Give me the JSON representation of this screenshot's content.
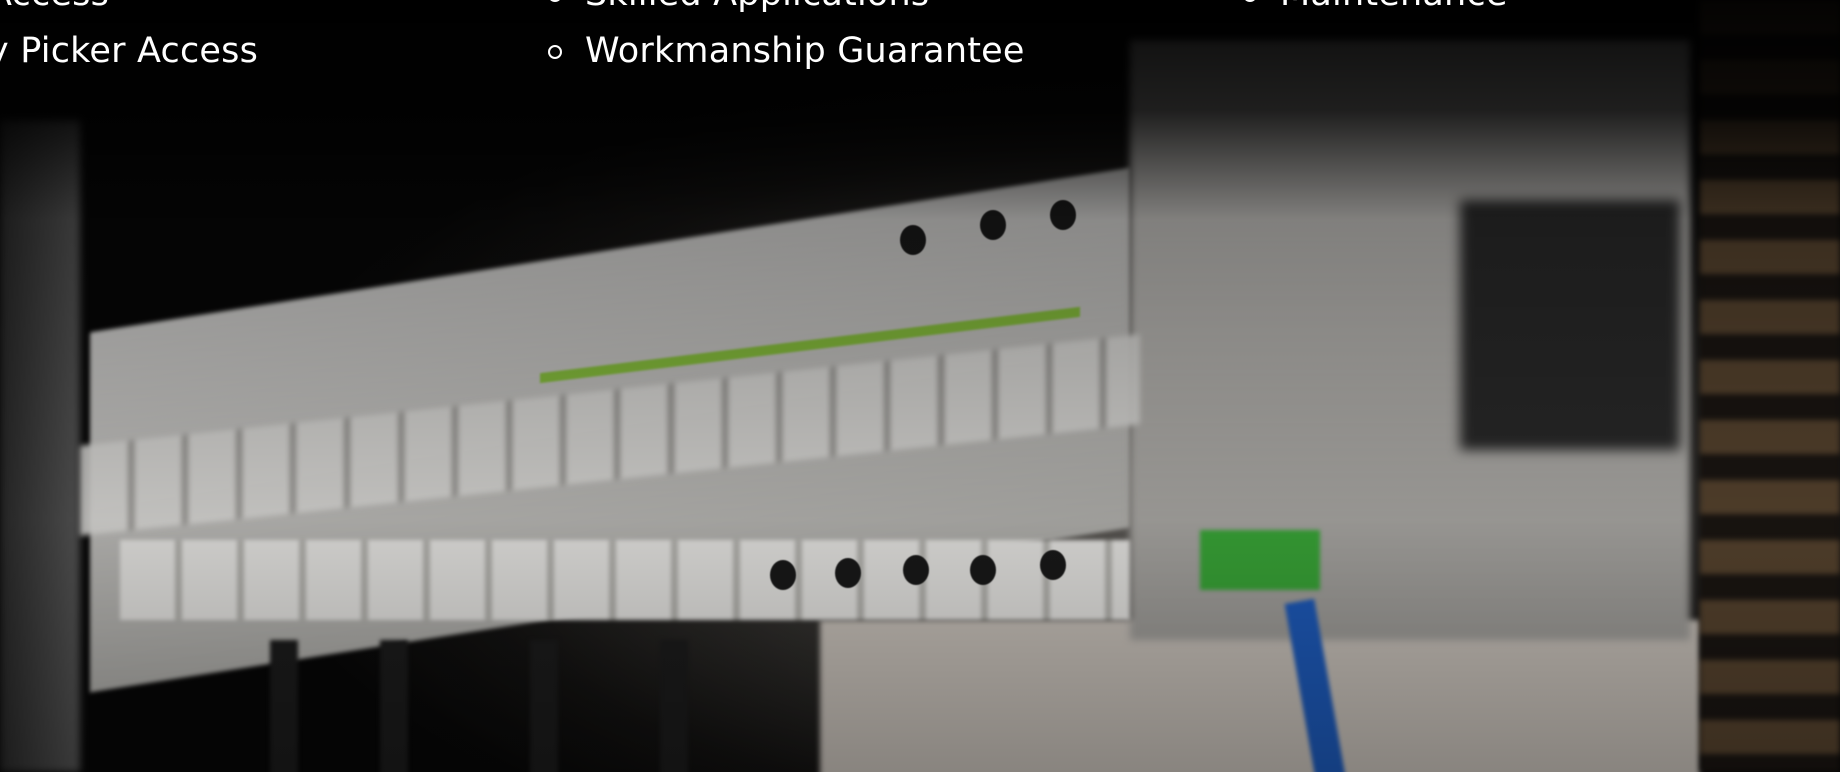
{
  "features": {
    "column_1": [
      {
        "label": "Access"
      },
      {
        "label": "y Picker Access"
      }
    ],
    "column_2": [
      {
        "label": "Skilled Applications"
      },
      {
        "label": "Workmanship Guarantee"
      }
    ],
    "column_3": [
      {
        "label": "Maintenance"
      }
    ]
  },
  "background": {
    "image_subject": "electrical-distribution-board-photo",
    "overlay_color": "#000000"
  },
  "colors": {
    "text": "#ffffff",
    "bullet": "#ffffff"
  }
}
